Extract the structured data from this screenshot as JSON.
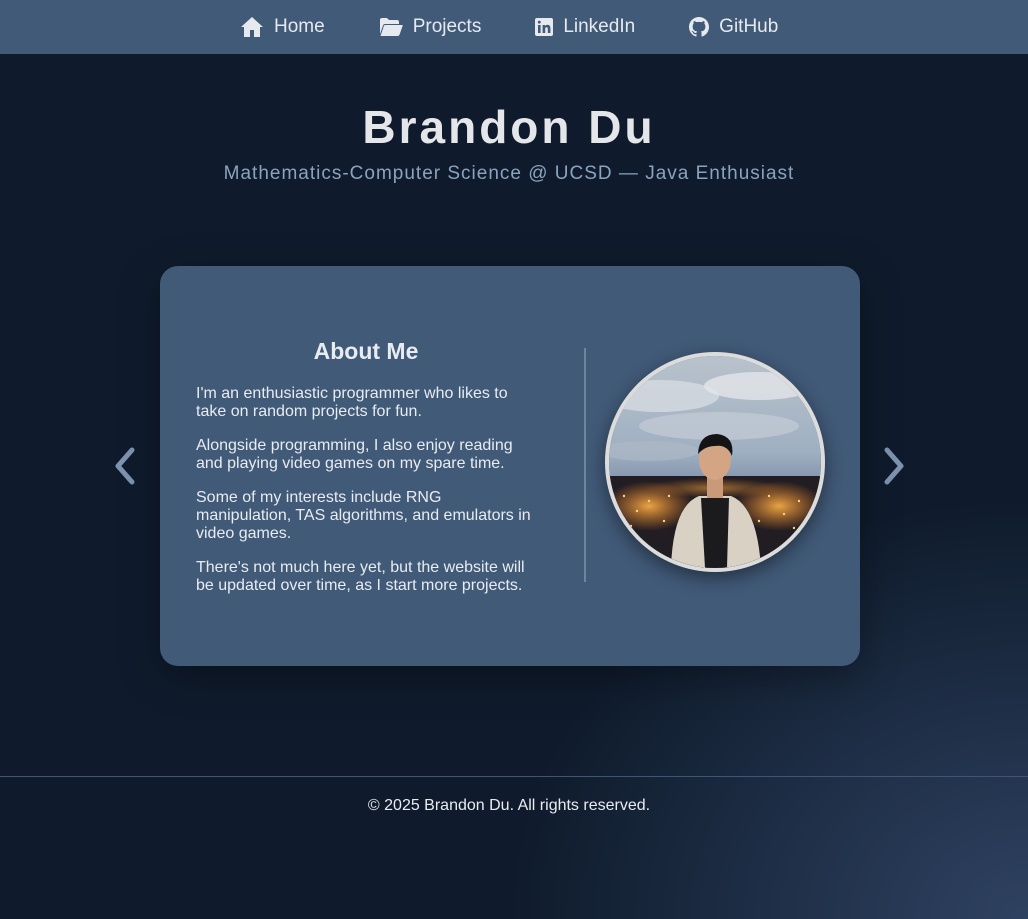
{
  "nav": {
    "items": [
      {
        "label": "Home",
        "icon": "home-icon"
      },
      {
        "label": "Projects",
        "icon": "folder-open-icon"
      },
      {
        "label": "LinkedIn",
        "icon": "linkedin-icon"
      },
      {
        "label": "GitHub",
        "icon": "github-icon"
      }
    ]
  },
  "header": {
    "name": "Brandon Du",
    "tagline": "Mathematics-Computer Science @ UCSD — Java Enthusiast"
  },
  "about": {
    "title": "About Me",
    "paragraphs": [
      "I'm an enthusiastic programmer who likes to take on random projects for fun.",
      "Alongside programming, I also enjoy reading and playing video games on my spare time.",
      "Some of my interests include RNG manipulation, TAS algorithms, and emulators in video games.",
      "There's not much here yet, but the website will be updated over time, as I start more projects."
    ]
  },
  "carousel": {
    "prev_icon": "chevron-left-icon",
    "next_icon": "chevron-right-icon"
  },
  "footer": {
    "text": "© 2025 Brandon Du. All rights reserved."
  },
  "colors": {
    "nav_bg": "#415a78",
    "page_bg": "#0f1b2c",
    "card_bg": "#415a78",
    "tagline": "#8aa3be",
    "arrow": "#7d93b0"
  }
}
